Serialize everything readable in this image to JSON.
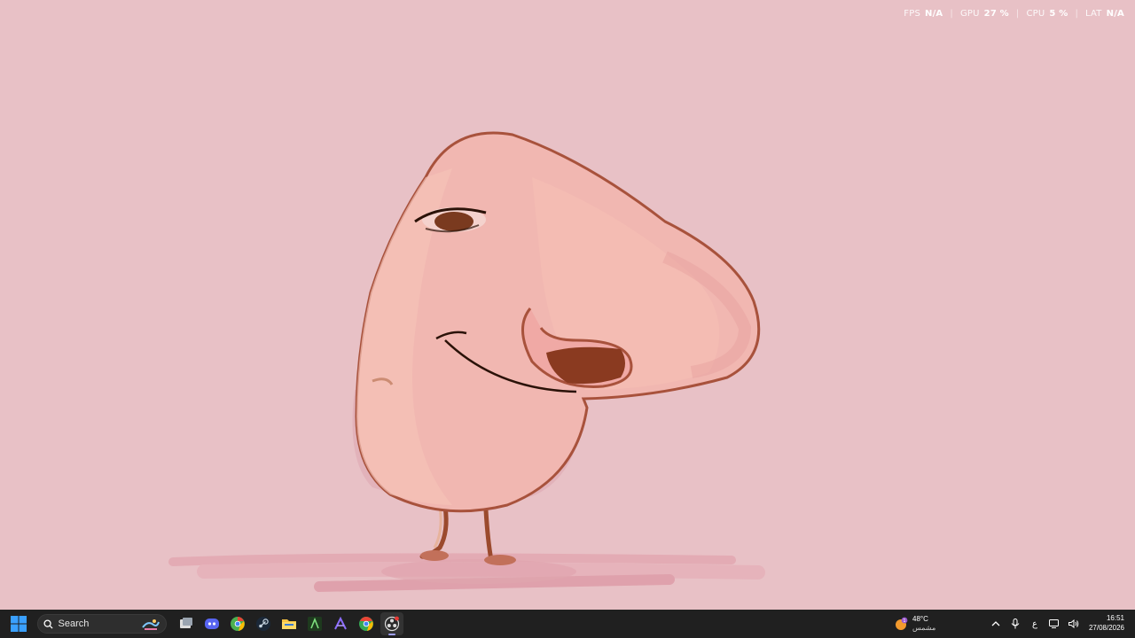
{
  "perf_overlay": {
    "items": [
      {
        "label": "FPS",
        "value": "N/A"
      },
      {
        "label": "GPU",
        "value": "27 %"
      },
      {
        "label": "CPU",
        "value": "5 %"
      },
      {
        "label": "LAT",
        "value": "N/A"
      }
    ]
  },
  "taskbar": {
    "search": {
      "placeholder": "Search"
    },
    "pinned_apps": [
      {
        "name": "task-view",
        "icon": "task-view-icon"
      },
      {
        "name": "discord",
        "icon": "discord-icon"
      },
      {
        "name": "chrome-alt",
        "icon": "chrome-icon"
      },
      {
        "name": "steam",
        "icon": "steam-icon"
      },
      {
        "name": "file-explorer",
        "icon": "folder-icon"
      },
      {
        "name": "terminal-app",
        "icon": "terminal-icon"
      },
      {
        "name": "arc-app",
        "icon": "arc-icon"
      },
      {
        "name": "chrome",
        "icon": "chrome-icon"
      },
      {
        "name": "obs",
        "icon": "obs-icon",
        "active": true
      }
    ],
    "weather": {
      "temp": "48°C",
      "condition": "مشمس",
      "badge": "1"
    },
    "tray": {
      "language": "ع"
    },
    "clock": {
      "time": "16:51",
      "date": "27/08/2026"
    }
  },
  "colors": {
    "wallpaper": "#e8c1c6",
    "taskbar": "#202020",
    "accent": "#0a84ff"
  }
}
